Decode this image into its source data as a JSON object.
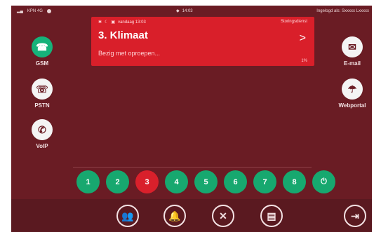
{
  "status_bar": {
    "left_text": "KPN 4G",
    "time": "14:03",
    "right_text": "Ingelogd als: Sxxxxx Lxxxxx"
  },
  "alert": {
    "top_left_text": "vandaag 13:03",
    "top_right_text": "Storingsdienst",
    "title": "3. Klimaat",
    "subtitle": "Bezig met oproepen...",
    "meta": "1%",
    "chevron": ">"
  },
  "left_buttons": [
    {
      "label": "GSM",
      "icon": "phone-icon"
    },
    {
      "label": "PSTN",
      "icon": "telephone-icon"
    },
    {
      "label": "VoIP",
      "icon": "voip-phone-icon"
    }
  ],
  "right_buttons": [
    {
      "label": "E-mail",
      "icon": "mail-icon"
    },
    {
      "label": "Webportal",
      "icon": "web-icon"
    }
  ],
  "zones": [
    {
      "label": "1"
    },
    {
      "label": "2"
    },
    {
      "label": "3",
      "active": true
    },
    {
      "label": "4"
    },
    {
      "label": "5"
    },
    {
      "label": "6"
    },
    {
      "label": "7"
    },
    {
      "label": "8"
    },
    {
      "label": "",
      "icon": "power-plug-icon"
    }
  ],
  "toolbar": [
    {
      "icon": "group-icon"
    },
    {
      "icon": "alarm-bell-icon"
    },
    {
      "icon": "tools-icon"
    },
    {
      "icon": "document-icon"
    },
    {
      "icon": "logout-icon"
    }
  ],
  "colors": {
    "background": "#6a1c24",
    "alert_red": "#d91f2a",
    "zone_green": "#17a86f"
  }
}
